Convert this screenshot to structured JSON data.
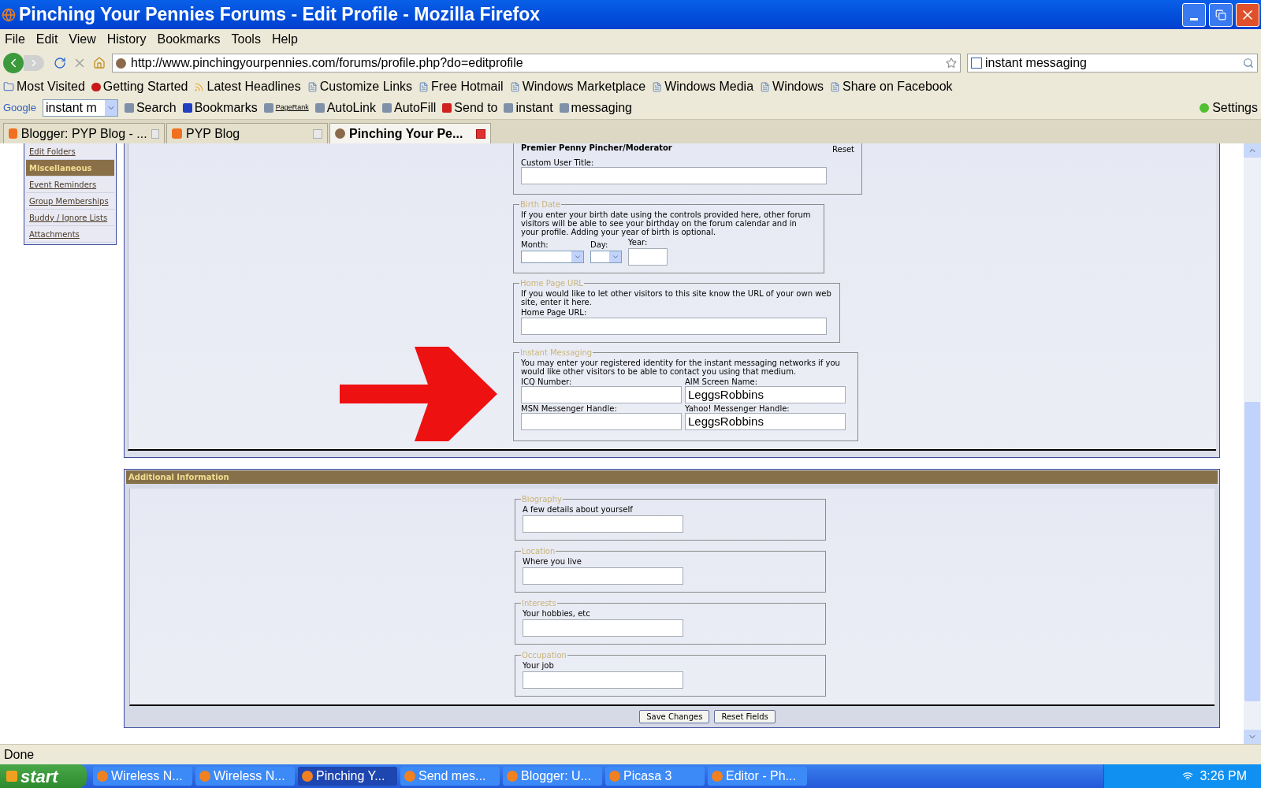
{
  "window": {
    "title": "Pinching Your Pennies Forums - Edit Profile - Mozilla Firefox"
  },
  "menu": [
    "File",
    "Edit",
    "View",
    "History",
    "Bookmarks",
    "Tools",
    "Help"
  ],
  "address_bar": {
    "value": "http://www.pinchingyourpennies.com/forums/profile.php?do=editprofile"
  },
  "search_bar": {
    "value": "instant messaging"
  },
  "bookmarks": [
    "Most Visited",
    "Getting Started",
    "Latest Headlines",
    "Customize Links",
    "Free Hotmail",
    "Windows Marketplace",
    "Windows Media",
    "Windows",
    "Share on Facebook"
  ],
  "google_toolbar": {
    "brand": "Google",
    "search_value": "instant m",
    "items": [
      "Search",
      "Bookmarks",
      "PageRank",
      "AutoLink",
      "AutoFill",
      "Send to",
      "instant",
      "messaging"
    ],
    "settings": "Settings"
  },
  "tabs": [
    {
      "label": "Blogger: PYP Blog - ...",
      "selected": false
    },
    {
      "label": "PYP Blog",
      "selected": false
    },
    {
      "label": "Pinching Your Pe...",
      "selected": true
    }
  ],
  "sidebar": {
    "items": [
      {
        "label": "Edit Folders",
        "selected": false
      },
      {
        "label": "Miscellaneous",
        "selected": true
      },
      {
        "label": "Event Reminders",
        "selected": false
      },
      {
        "label": "Group Memberships",
        "selected": false
      },
      {
        "label": "Buddy / Ignore Lists",
        "selected": false
      },
      {
        "label": "Attachments",
        "selected": false
      }
    ]
  },
  "profile_section": {
    "user_title": "Premier Penny Pincher/Moderator",
    "reset": "Reset",
    "custom_title_label": "Custom User Title:",
    "groups": [
      {
        "legend": "Birth Date",
        "kind": "inline",
        "description": "If you enter your birth date using the controls provided here, other forum visitors will be able to see your birthday on the forum calendar and in your profile. Adding your year of birth is optional.",
        "fields": [
          {
            "label": "Month:",
            "kind": "select"
          },
          {
            "label": "Day:",
            "kind": "select"
          },
          {
            "label": "Year:",
            "kind": "text"
          }
        ]
      },
      {
        "legend": "Home Page URL",
        "kind": "stack",
        "description": "If you would like to let other visitors to this site know the URL of your own web site, enter it here.",
        "fields": [
          {
            "label": "Home Page URL:",
            "kind": "text"
          }
        ]
      },
      {
        "legend": "Instant Messaging",
        "kind": "grid",
        "description": "You may enter your registered identity for the instant messaging networks if you would like other visitors to be able to contact you using that medium.",
        "fields": [
          {
            "label": "ICQ Number:",
            "kind": "text"
          },
          {
            "label": "AIM Screen Name:",
            "kind": "text",
            "value": "LeggsRobbins"
          },
          {
            "label": "MSN Messenger Handle:",
            "kind": "text"
          },
          {
            "label": "Yahoo! Messenger Handle:",
            "kind": "text",
            "value": "LeggsRobbins"
          }
        ]
      }
    ]
  },
  "additional_section": {
    "title": "Additional Information",
    "groups": [
      {
        "legend": "Biography",
        "kind": "short",
        "description": "A few details about yourself",
        "fields": [
          {
            "kind": "text"
          }
        ]
      },
      {
        "legend": "Location",
        "kind": "short",
        "description": "Where you live",
        "fields": [
          {
            "kind": "text"
          }
        ]
      },
      {
        "legend": "Interests",
        "kind": "short",
        "description": "Your hobbies, etc",
        "fields": [
          {
            "kind": "text"
          }
        ]
      },
      {
        "legend": "Occupation",
        "kind": "short",
        "description": "Your job",
        "fields": [
          {
            "kind": "text"
          }
        ]
      }
    ],
    "buttons": [
      "Save Changes",
      "Reset Fields"
    ]
  },
  "status_bar": "Done",
  "taskbar": {
    "start": "start",
    "items": [
      {
        "label": "Wireless N...",
        "selected": false
      },
      {
        "label": "Wireless N...",
        "selected": false
      },
      {
        "label": "Pinching Y...",
        "selected": true
      },
      {
        "label": "Send mes...",
        "selected": false
      },
      {
        "label": "Blogger: U...",
        "selected": false
      },
      {
        "label": "Picasa 3",
        "selected": false
      },
      {
        "label": "Editor - Ph...",
        "selected": false
      }
    ],
    "clock": "3:26 PM"
  }
}
